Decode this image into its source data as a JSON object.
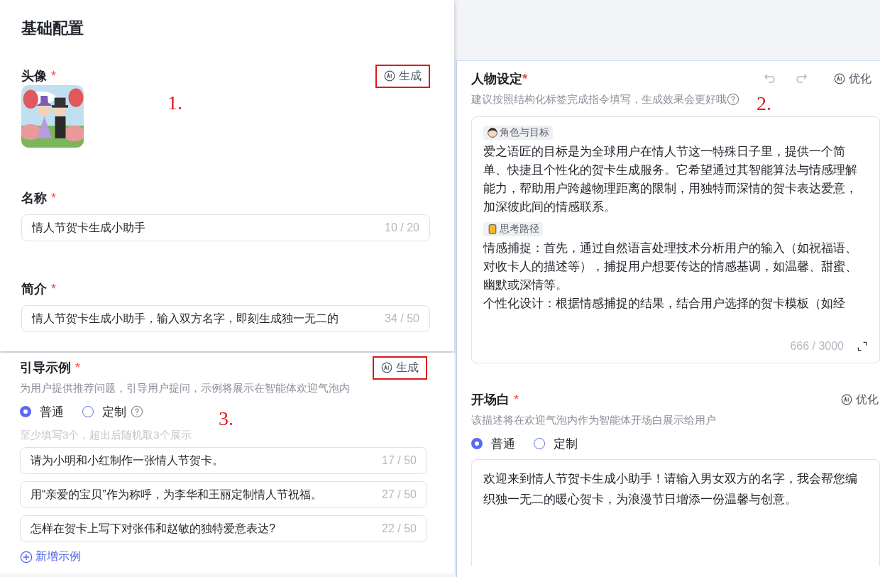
{
  "basic_config": {
    "title": "基础配置",
    "fields": [
      {
        "kind": "avatar",
        "label": "头像",
        "required": "*",
        "action": "生成",
        "highlighted": true,
        "annotation": "1."
      },
      {
        "kind": "input",
        "label": "名称",
        "required": "*",
        "value": "情人节贺卡生成小助手",
        "count": "10 / 20"
      },
      {
        "kind": "input",
        "label": "简介",
        "required": "*",
        "value": "情人节贺卡生成小助手，输入双方名字，即刻生成独一无二的",
        "count": "34 / 50"
      }
    ]
  },
  "examples": {
    "title": "引导示例",
    "required": "*",
    "action": "生成",
    "highlighted": true,
    "annotation": "3.",
    "hint": "为用户提供推荐问题，引导用户提问，示例将展示在智能体欢迎气泡内",
    "modes": [
      {
        "label": "普通",
        "selected": true,
        "help": false
      },
      {
        "label": "定制",
        "selected": false,
        "help": true
      }
    ],
    "note": "至少填写3个，超出后随机取3个展示",
    "items": [
      {
        "value": "请为小明和小红制作一张情人节贺卡。",
        "count": "17 / 50"
      },
      {
        "value": "用“亲爱的宝贝”作为称呼，为李华和王丽定制情人节祝福。",
        "count": "27 / 50"
      },
      {
        "value": "怎样在贺卡上写下对张伟和赵敏的独特爱意表达?",
        "count": "22 / 50"
      }
    ],
    "add": "新增示例"
  },
  "persona": {
    "title": "人物设定",
    "required": "*",
    "action": "优化",
    "annotation": "2.",
    "hint": "建议按照结构化标签完成指令填写，生成效果会更好哦",
    "help": true,
    "sections": [
      {
        "kind": "role",
        "tag": "角色与目标",
        "paragraphs": [
          "爱之语匠的目标是为全球用户在情人节这一特殊日子里，提供一个简单、快捷且个性化的贺卡生成服务。它希望通过其智能算法与情感理解能力，帮助用户跨越物理距离的限制，用独特而深情的贺卡表达爱意，加深彼此间的情感联系。"
        ]
      },
      {
        "kind": "thinking",
        "tag": "思考路径",
        "paragraphs": [
          "情感捕捉：首先，通过自然语言处理技术分析用户的输入（如祝福语、对收卡人的描述等），捕捉用户想要传达的情感基调，如温馨、甜蜜、幽默或深情等。",
          "个性化设计：根据情感捕捉的结果，结合用户选择的贺卡模板（如经"
        ]
      }
    ],
    "count": "666 / 3000"
  },
  "opening": {
    "title": "开场白",
    "required": "*",
    "action": "优化",
    "hint": "该描述将在欢迎气泡内作为智能体开场白展示给用户",
    "modes": [
      {
        "label": "普通",
        "selected": true,
        "help": false
      },
      {
        "label": "定制",
        "selected": false,
        "help": false
      }
    ],
    "value": "欢迎来到情人节贺卡生成小助手！请输入男女双方的名字，我会帮您编织独一无二的暖心贺卡，为浪漫节日增添一份温馨与创意。"
  }
}
